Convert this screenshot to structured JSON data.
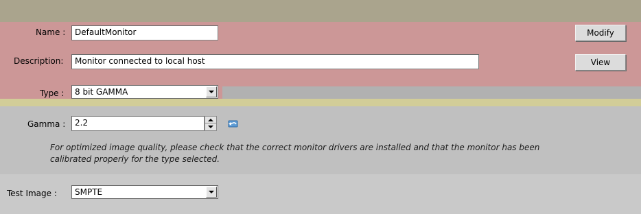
{
  "name_field": {
    "label": "Name :",
    "value": "DefaultMonitor"
  },
  "description_field": {
    "label": "Description:",
    "value": "Monitor connected to local host"
  },
  "type_field": {
    "label": "Type :",
    "value": "8 bit GAMMA"
  },
  "gamma_field": {
    "label": "Gamma :",
    "value": "2.2"
  },
  "note": {
    "line1": "For optimized image quality, please check that the correct monitor drivers are installed and that the monitor has been",
    "line2": "calibrated properly for the type selected."
  },
  "test_image_field": {
    "label": "Test Image :",
    "value": "SMPTE"
  },
  "buttons": {
    "modify": "Modify",
    "view": "View"
  },
  "icons": {
    "reset": "reset-arrow-icon"
  },
  "colors": {
    "header_band": "#aaa48d",
    "pink_section": "#cc9797",
    "yellow_separator": "#d2cd98",
    "gray_section": "#c0c0c0"
  }
}
